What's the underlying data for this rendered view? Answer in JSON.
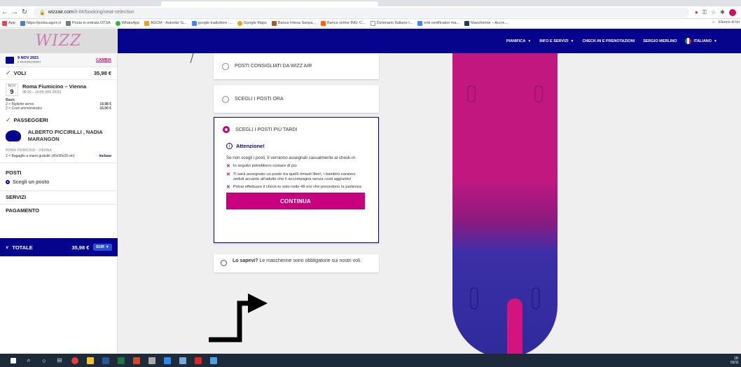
{
  "browser": {
    "url_host": "wizzair.com",
    "url_path": "/it-it#/booking/seat-selection",
    "bookmarks": [
      {
        "label": "App",
        "color": "#e04b4b"
      },
      {
        "label": "https://posta.agcm.it",
        "color": "#4a7bd8"
      },
      {
        "label": "Posta in entrata DTSA",
        "color": "#7a7a7a"
      },
      {
        "label": "WhatsApp",
        "color": "#2bb741"
      },
      {
        "label": "AGCM - Autorita' G...",
        "color": "#e8a21b"
      },
      {
        "label": "google traduttore -...",
        "color": "#4285f4"
      },
      {
        "label": "Google Maps",
        "color": "#e8a21b"
      },
      {
        "label": "Banca Intesa Sanpa...",
        "color": "#a0602a"
      },
      {
        "label": "Banca online ING: C...",
        "color": "#ff6200"
      },
      {
        "label": "Dizionario Italiano-I...",
        "color": "#ffffff"
      },
      {
        "label": "enti certificatori ma...",
        "color": "#4285f4"
      },
      {
        "label": "Mascherine – Accre...",
        "color": "#1f3a5a"
      }
    ],
    "bookmarks_more": "»",
    "other_bookmarks": "Elenco di let"
  },
  "nav": {
    "items": [
      "PIANIFICA",
      "INFO E SERVIZI",
      "CHECK-IN E PRENOTAZIONI",
      "SERGIO MERLINO",
      "ITALIANO"
    ],
    "logo": "WIZZ"
  },
  "sidebar": {
    "date": "9 NOV 2021",
    "passengers_count": "2 PASSEGGERI",
    "change": "CAMBIA",
    "flights_label": "VOLI",
    "flights_price": "35,98 €",
    "flight_month": "NOV",
    "flight_day": "9",
    "flight_route": "Roma Fiumicino – Vienna",
    "flight_time": "08:20 – 10:05 (W6 2816)",
    "fare": "Basic",
    "ticket_label": "2 × Biglietto aereo",
    "ticket_price": "19,98 €",
    "admin_label": "2 × Costi amministrativi",
    "admin_price": "16,00 €",
    "passengers_label": "PASSEGGERI",
    "passenger_names": "ALBERTO PICCIRILLI , NADIA MARANGON",
    "route_caps": "ROMA FIUMICINO - VIENNA",
    "bag_label": "2 × Bagaglio a mano gratuito (40x30x20 cm)",
    "bag_value": "incluso",
    "seats_label": "POSTI",
    "seat_choice": "Scegli un posto",
    "services_label": "SERVIZI",
    "payment_label": "PAGAMENTO",
    "total_label": "TOTALE",
    "total_price": "35,98 €",
    "currency": "EUR"
  },
  "seat_options": {
    "recommended": "POSTI CONSIGLIATI DA WIZZ AIR",
    "choose_now": "SCEGLI I POSTI ORA",
    "choose_later": "SCEGLI I POSTI PIÙ TARDI",
    "attention_title": "Attenzione!",
    "attention_text": "Se non scegli i posti, ti verranno assegnati casualmente al check-in",
    "bullets": [
      "In seguito potrebbero costare di più",
      "Ti sarà assegnato un posto tra quelli rimasti liberi, i bambini saranno seduti accanto all'adulto che li accompagna senza costi aggiuntivi",
      "Potrai effettuare il check-in solo nelle 48 ore che precedono la partenza"
    ],
    "continue_button": "CONTINUA",
    "tip_bold": "Lo sapevi?",
    "tip_text": " Le mascherine sono obbligatorie sui nostri voli."
  },
  "taskbar": {
    "clock_time": "18:",
    "clock_date": "03/11"
  },
  "colors": {
    "brand_navy": "#06038d",
    "brand_magenta": "#c6007e"
  }
}
